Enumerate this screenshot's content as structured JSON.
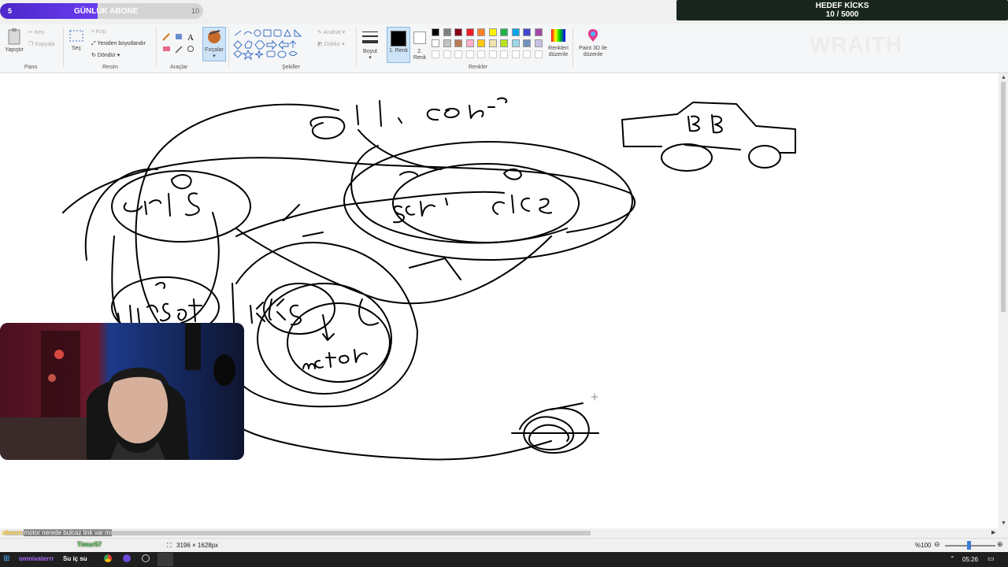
{
  "overlay": {
    "sub_count": "5",
    "sub_title": "GÜNLÜK ABONE",
    "sub_goal": "10",
    "sub_progress": 0.48,
    "goal_title": "HEDEF KİCKS",
    "goal_value": "10 / 5000",
    "brand": "WRAITH",
    "chat_user": "alboon",
    "chat_message": "motor nerede bulcaz link var mı",
    "chat_user2": "omnivaterrr",
    "chat_message2": "Su iç su",
    "chat_user3": "Timur57"
  },
  "ribbon": {
    "clipboard": {
      "paste": "Yapıştır",
      "cut": "Kes",
      "copy": "Kopyala",
      "group": "Pano"
    },
    "image": {
      "select": "Seç",
      "crop": "Kırp",
      "resize": "Yeniden boyutlandır",
      "rotate": "Döndür",
      "group": "Resim"
    },
    "tools": {
      "group": "Araçlar"
    },
    "brushes": {
      "label": "Fırçalar"
    },
    "shapes": {
      "outline": "Anahat",
      "fill": "Doldur",
      "group": "Şekiller"
    },
    "size": {
      "label": "Boyut"
    },
    "color1": {
      "label": "1. Renk"
    },
    "color2": {
      "label": "2. Renk"
    },
    "colors": {
      "group": "Renkler",
      "edit": "Renkleri düzenle",
      "paint3d": "Paint 3D ile düzenle"
    },
    "palette_row1": [
      "#000000",
      "#7f7f7f",
      "#880015",
      "#ed1c24",
      "#ff7f27",
      "#fff200",
      "#22b14c",
      "#00a2e8",
      "#3f48cc",
      "#a349a4"
    ],
    "palette_row2": [
      "#ffffff",
      "#c3c3c3",
      "#b97a57",
      "#ffaec9",
      "#ffc90e",
      "#efe4b0",
      "#b5e61d",
      "#99d9ea",
      "#7092be",
      "#c8bfe7"
    ]
  },
  "canvas": {
    "word_top": "ulıcob",
    "word_eris": "eris",
    "word_soru": "sor",
    "word_cice": "cice",
    "word_kirsat": "kirsat",
    "word_krks": "krks",
    "word_motor": "motor",
    "word_car": "BB"
  },
  "statusbar": {
    "dimensions": "3196 × 1628px",
    "zoom": "%100"
  },
  "taskbar": {
    "time": "05:26"
  }
}
